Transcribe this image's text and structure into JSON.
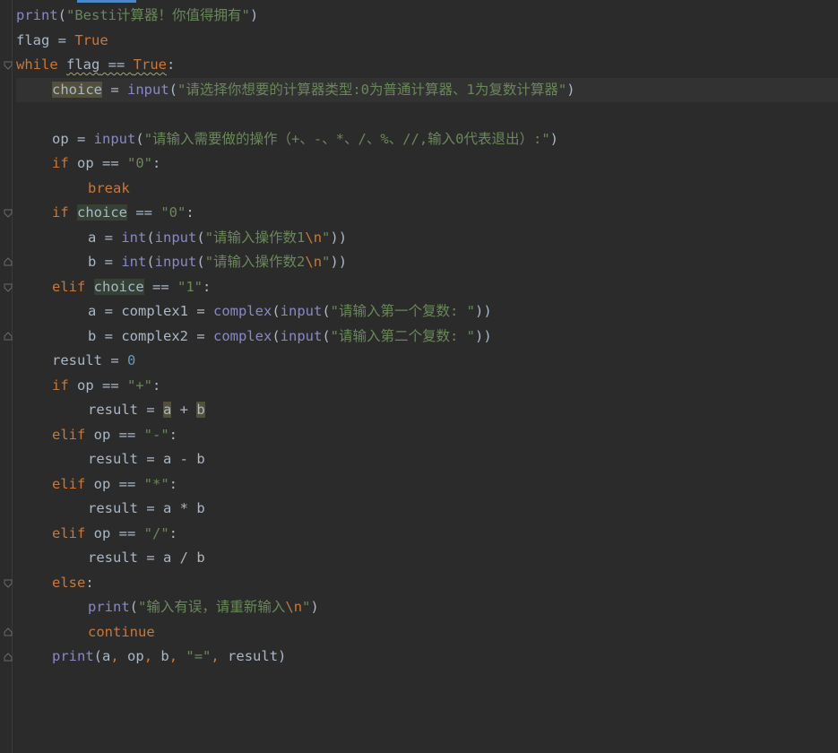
{
  "colors": {
    "background": "#2b2b2b",
    "keyword": "#cc7832",
    "string": "#6a8759",
    "number": "#6897bb",
    "builtin": "#8888c6",
    "text": "#a9b7c6",
    "current_line": "#323232"
  },
  "lines": [
    {
      "t1": "print",
      "t2": "(",
      "t3": "\"Besti计算器！你值得拥有\"",
      "t4": ")"
    },
    {
      "t1": "flag",
      "t2": " = ",
      "t3": "True"
    },
    {
      "t1": "while",
      "t2": " ",
      "t3": "flag",
      "t4": " == ",
      "t5": "True",
      "t6": ":"
    },
    {
      "t1": "choice",
      "t2": " = ",
      "t3": "input",
      "t4": "(",
      "t5": "\"请选择你想要的计算器类型:0为普通计算器、1为复数计算器\"",
      "t6": ")"
    },
    {},
    {
      "t1": "op",
      "t2": " = ",
      "t3": "input",
      "t4": "(",
      "t5": "\"请输入需要做的操作（+、-、*、/、%、//,输入0代表退出）:\"",
      "t6": ")"
    },
    {
      "t1": "if",
      "t2": " op == ",
      "t3": "\"0\"",
      "t4": ":"
    },
    {
      "t1": "break"
    },
    {
      "t1": "if",
      "t2": " ",
      "t3": "choice",
      "t4": " == ",
      "t5": "\"0\"",
      "t6": ":"
    },
    {
      "t1": "a = ",
      "t2": "int",
      "t3": "(",
      "t4": "input",
      "t5": "(",
      "t6": "\"请输入操作数1",
      "t7": "\\n",
      "t8": "\"",
      "t9": "))"
    },
    {
      "t1": "b = ",
      "t2": "int",
      "t3": "(",
      "t4": "input",
      "t5": "(",
      "t6": "\"请输入操作数2",
      "t7": "\\n",
      "t8": "\"",
      "t9": "))"
    },
    {
      "t1": "elif",
      "t2": " ",
      "t3": "choice",
      "t4": " == ",
      "t5": "\"1\"",
      "t6": ":"
    },
    {
      "t1": "a = complex1 = ",
      "t2": "complex",
      "t3": "(",
      "t4": "input",
      "t5": "(",
      "t6": "\"请输入第一个复数: \"",
      "t7": "))"
    },
    {
      "t1": "b = complex2 = ",
      "t2": "complex",
      "t3": "(",
      "t4": "input",
      "t5": "(",
      "t6": "\"请输入第二个复数: \"",
      "t7": "))"
    },
    {
      "t1": "result = ",
      "t2": "0"
    },
    {
      "t1": "if",
      "t2": " op == ",
      "t3": "\"+\"",
      "t4": ":"
    },
    {
      "t1": "result = ",
      "t2": "a",
      "t3": " + ",
      "t4": "b"
    },
    {
      "t1": "elif",
      "t2": " op == ",
      "t3": "\"-\"",
      "t4": ":"
    },
    {
      "t1": "result = a - b"
    },
    {
      "t1": "elif",
      "t2": " op == ",
      "t3": "\"*\"",
      "t4": ":"
    },
    {
      "t1": "result = a * b"
    },
    {
      "t1": "elif",
      "t2": " op == ",
      "t3": "\"/\"",
      "t4": ":"
    },
    {
      "t1": "result = a / b"
    },
    {
      "t1": "else",
      "t2": ":"
    },
    {
      "t1": "print",
      "t2": "(",
      "t3": "\"输入有误，请重新输入",
      "t4": "\\n",
      "t5": "\"",
      "t6": ")"
    },
    {
      "t1": "continue"
    },
    {
      "t1": "print",
      "t2": "(a",
      "t3": ", ",
      "t4": "op",
      "t5": ", ",
      "t6": "b",
      "t7": ", ",
      "t8": "\"=\"",
      "t9": ", ",
      "t10": "result)"
    }
  ]
}
